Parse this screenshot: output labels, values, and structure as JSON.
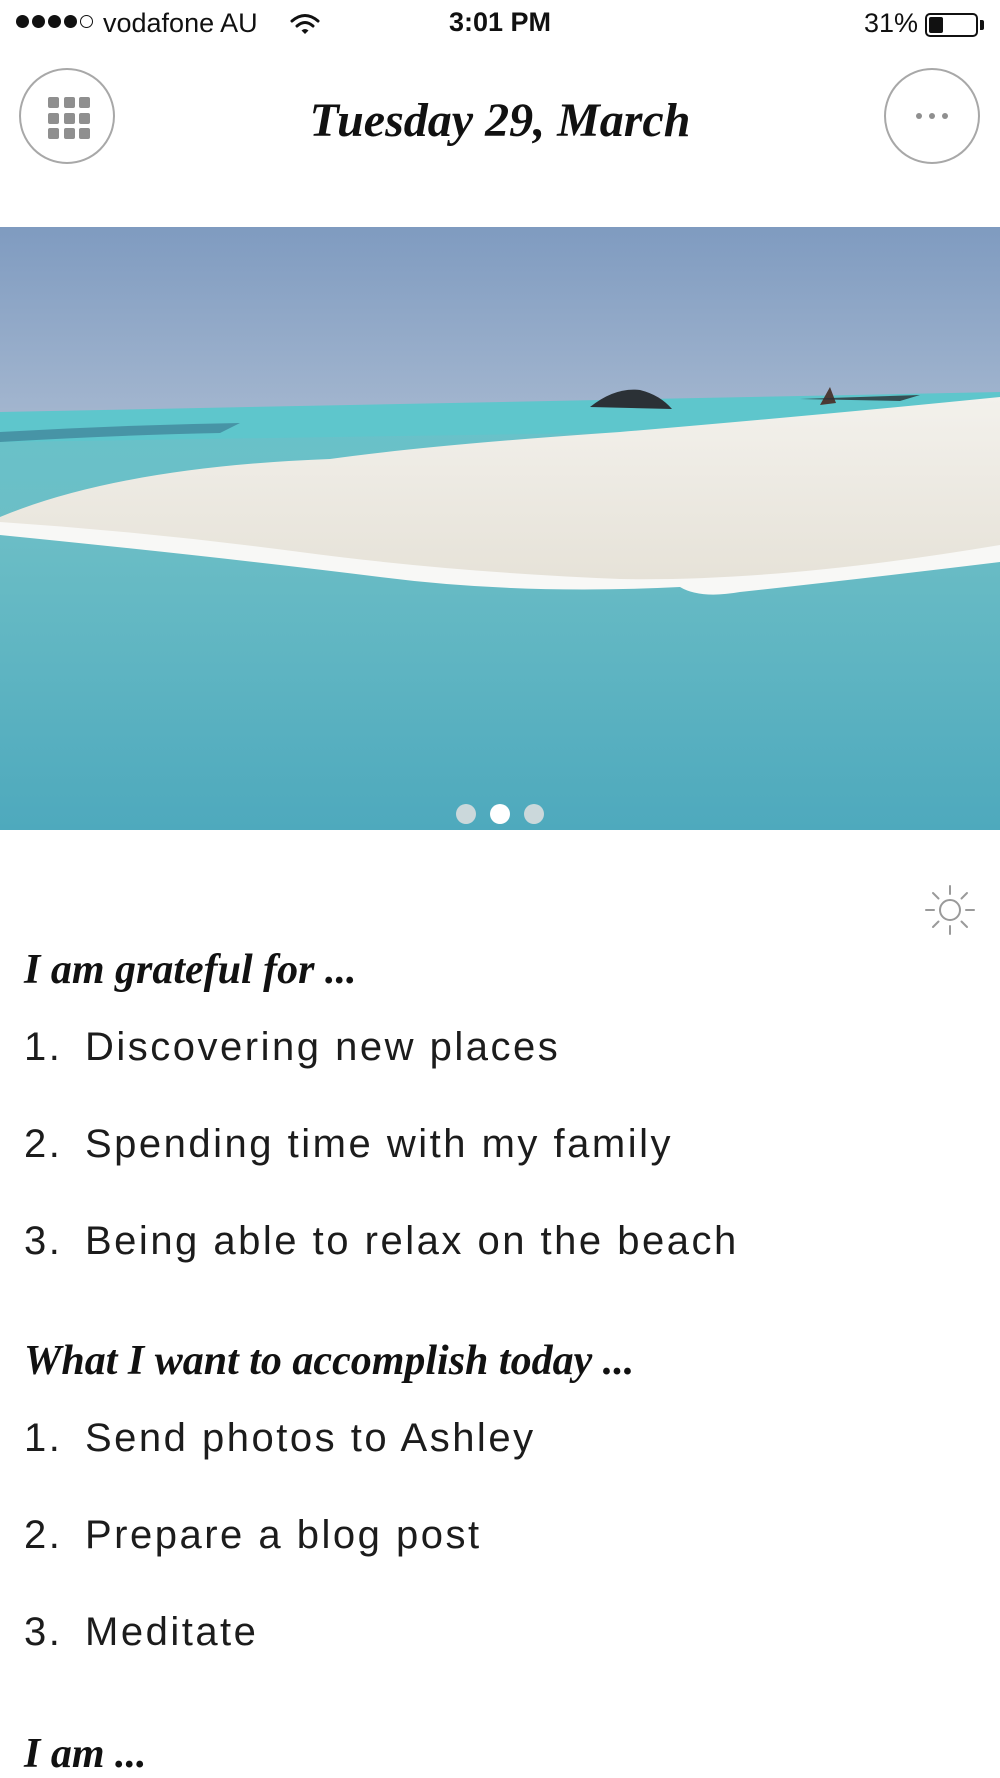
{
  "status_bar": {
    "carrier": "vodafone AU",
    "time": "3:01 PM",
    "battery_percent": "31%",
    "battery_level": 0.31,
    "signal_bars_filled": 4,
    "signal_bars_total": 5
  },
  "header": {
    "date_title": "Tuesday 29, March",
    "menu_icon": "grid-icon",
    "more_icon": "ellipsis-icon"
  },
  "carousel": {
    "image_description_icon": "beach-photo",
    "page_count": 3,
    "active_page": 2
  },
  "theme_toggle_icon": "sun-icon",
  "sections": [
    {
      "heading": "I am grateful for ...",
      "items": [
        {
          "num": "1.",
          "text": "Discovering new places"
        },
        {
          "num": "2.",
          "text": "Spending time with my family"
        },
        {
          "num": "3.",
          "text": "Being able to relax on the beach"
        }
      ]
    },
    {
      "heading": "What I want to accomplish today ...",
      "items": [
        {
          "num": "1.",
          "text": "Send photos to Ashley"
        },
        {
          "num": "2.",
          "text": "Prepare a blog post"
        },
        {
          "num": "3.",
          "text": "Meditate"
        }
      ]
    },
    {
      "heading": "I am ...",
      "items": []
    }
  ],
  "colors": {
    "sky": "#8aa3c4",
    "sea": "#5fb5c3",
    "sand": "#ece9e1",
    "button_border": "#a8a8a8",
    "icon_gray": "#8f8f8f"
  }
}
